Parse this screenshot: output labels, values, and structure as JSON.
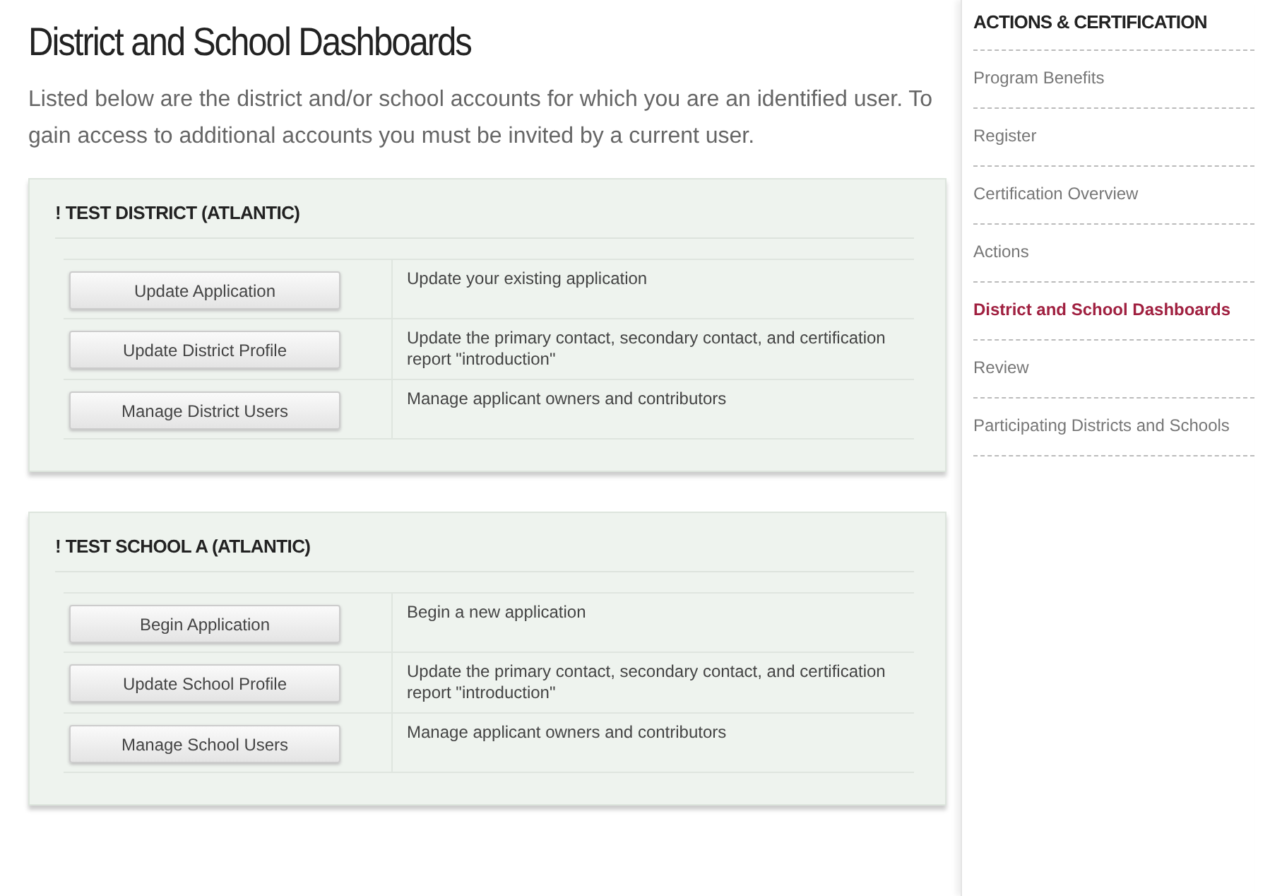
{
  "page": {
    "title": "District and School Dashboards",
    "intro": "Listed below are the district and/or school accounts for which you are an identified user. To gain access to additional accounts you must be invited by a current user."
  },
  "accounts": [
    {
      "name": "! TEST DISTRICT (ATLANTIC)",
      "actions": [
        {
          "button": "Update Application",
          "description": "Update your existing application"
        },
        {
          "button": "Update District Profile",
          "description": "Update the primary contact, secondary contact, and certification report \"introduction\""
        },
        {
          "button": "Manage District Users",
          "description": "Manage applicant owners and contributors"
        }
      ]
    },
    {
      "name": "! TEST SCHOOL A (ATLANTIC)",
      "actions": [
        {
          "button": "Begin Application",
          "description": "Begin a new application"
        },
        {
          "button": "Update School Profile",
          "description": "Update the primary contact, secondary contact, and certification report \"introduction\""
        },
        {
          "button": "Manage School Users",
          "description": "Manage applicant owners and contributors"
        }
      ]
    }
  ],
  "sidebar": {
    "heading": "ACTIONS & CERTIFICATION",
    "items": [
      {
        "label": "Program Benefits",
        "selected": false
      },
      {
        "label": "Register",
        "selected": false
      },
      {
        "label": "Certification Overview",
        "selected": false
      },
      {
        "label": "Actions",
        "selected": false
      },
      {
        "label": "District and School Dashboards",
        "selected": true
      },
      {
        "label": "Review",
        "selected": false
      },
      {
        "label": "Participating Districts and Schools",
        "selected": false
      }
    ]
  }
}
